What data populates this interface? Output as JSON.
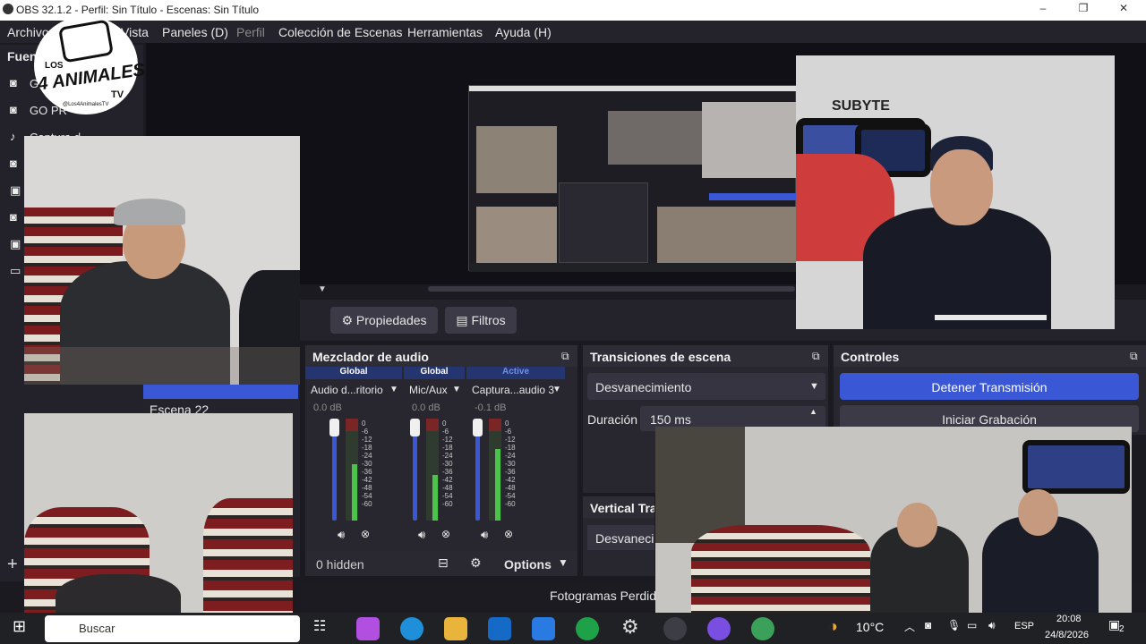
{
  "window": {
    "title": "OBS 32.1.2 - Perfil: Sin Título - Escenas: Sin Título"
  },
  "menu": [
    "Archivo",
    "Vista",
    "Paneles (D)",
    "Perfil",
    "Colección de Escenas",
    "Herramientas",
    "Ayuda (H)"
  ],
  "logo": {
    "line1": "LOS",
    "line2": "4 ANIMALES",
    "line3": "TV",
    "handle": "@Los4AnimalesTV"
  },
  "sources": {
    "header": "Fuen",
    "items": [
      {
        "label": "G",
        "icon": "camera-icon"
      },
      {
        "label": "GO PR",
        "icon": "camera-icon"
      },
      {
        "label": "Captura d",
        "icon": "microphone-icon"
      },
      {
        "label": "",
        "icon": "camera-icon"
      },
      {
        "label": "",
        "icon": "image-icon"
      },
      {
        "label": "",
        "icon": "camera-icon"
      },
      {
        "label": "",
        "icon": "image-icon"
      },
      {
        "label": "",
        "icon": "monitor-icon"
      }
    ]
  },
  "scenes": {
    "items": [
      "Escena 22"
    ]
  },
  "props_bar": {
    "properties": "Propiedades",
    "filters": "Filtros"
  },
  "mixer": {
    "title": "Mezclador de audio",
    "channels": [
      {
        "tag": "Global",
        "name": "Audio d...ritorio",
        "db": "0.0 dB",
        "level": 0.55
      },
      {
        "tag": "Global",
        "name": "Mic/Aux",
        "db": "0.0 dB",
        "level": 0.45
      },
      {
        "tag": "Active",
        "name": "Captura...audio 3",
        "db": "-0.1 dB",
        "level": 0.7
      }
    ],
    "ticks": [
      "0",
      "-6",
      "-12",
      "-18",
      "-24",
      "-30",
      "-36",
      "-42",
      "-48",
      "-54",
      "-60"
    ],
    "hidden": "0 hidden",
    "options": "Options"
  },
  "transitions": {
    "title": "Transiciones de escena",
    "selected": "Desvanecimiento",
    "duration_label": "Duración",
    "duration": "150 ms"
  },
  "vertical": {
    "title": "Vertical Tra",
    "selected": "Desvanecir"
  },
  "controls": {
    "title": "Controles",
    "stop_stream": "Detener Transmisión",
    "start_record": "Iniciar Grabación"
  },
  "statusbar": {
    "dropped": "Fotogramas Perdid"
  },
  "taskbar": {
    "search": "Buscar",
    "weather": "10°C",
    "lang": "ESP",
    "time": "20:08",
    "date": "24/8/2026",
    "notif": "2"
  },
  "wall": {
    "sign": "SUBYTE"
  },
  "colors": {
    "accent": "#3a57d6",
    "panel": "#28272f",
    "meter_green": "#4cc44c",
    "meter_red": "#c03030"
  }
}
